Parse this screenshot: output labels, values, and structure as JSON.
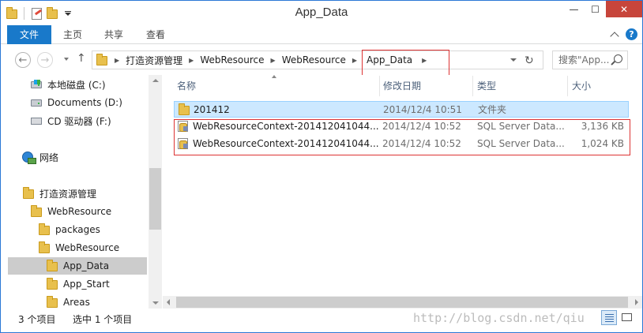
{
  "window": {
    "title": "App_Data",
    "controls": {
      "minimize": "—",
      "maximize": "☐",
      "close": "✕"
    }
  },
  "ribbon": {
    "tabs": [
      "文件",
      "主页",
      "共享",
      "查看"
    ]
  },
  "address": {
    "back": "←",
    "forward": "→",
    "up": "↑",
    "refresh": "↻",
    "crumbs": [
      "打造资源管理",
      "WebResource",
      "WebResource",
      "App_Data"
    ],
    "search_placeholder": "搜索\"App..."
  },
  "nav": {
    "items": [
      {
        "label": "本地磁盘 (C:)",
        "icon": "windows-drive-icon"
      },
      {
        "label": "Documents (D:)",
        "icon": "drive-icon"
      },
      {
        "label": "CD 驱动器 (F:)",
        "icon": "cd-drive-icon"
      },
      {
        "label": "网络",
        "icon": "network-icon"
      },
      {
        "label": "打造资源管理",
        "icon": "folder-icon"
      },
      {
        "label": "WebResource",
        "icon": "folder-icon"
      },
      {
        "label": "packages",
        "icon": "folder-icon"
      },
      {
        "label": "WebResource",
        "icon": "folder-icon"
      },
      {
        "label": "App_Data",
        "icon": "folder-icon",
        "selected": true
      },
      {
        "label": "App_Start",
        "icon": "folder-icon"
      },
      {
        "label": "Areas",
        "icon": "folder-icon"
      }
    ]
  },
  "columns": [
    "名称",
    "修改日期",
    "类型",
    "大小"
  ],
  "files": [
    {
      "name": "201412",
      "date": "2014/12/4 10:51",
      "type": "文件夹",
      "size": "",
      "icon": "folder-icon",
      "selected": true
    },
    {
      "name": "WebResourceContext-201412041044...",
      "date": "2014/12/4 10:52",
      "type": "SQL Server Data...",
      "size": "3,136 KB",
      "icon": "sql-database-icon"
    },
    {
      "name": "WebResourceContext-201412041044...",
      "date": "2014/12/4 10:52",
      "type": "SQL Server Data...",
      "size": "1,024 KB",
      "icon": "sql-database-icon"
    }
  ],
  "status": {
    "count": "3 个项目",
    "selected": "选中 1 个项目"
  },
  "watermark": "http://blog.csdn.net/qiu",
  "colors": {
    "accent": "#1979ca",
    "close": "#c7453b",
    "selection": "#cce8ff",
    "annotation": "#dd3333"
  }
}
